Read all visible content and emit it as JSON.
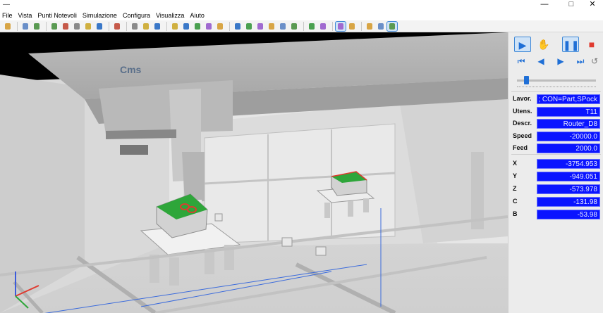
{
  "window": {
    "title": "",
    "controls": {
      "minimize": "—",
      "maximize": "□",
      "close": "✕"
    }
  },
  "menu": [
    "File",
    "Vista",
    "Punti Notevoli",
    "Simulazione",
    "Configura",
    "Visualizza",
    "Aiuto"
  ],
  "toolbar": {
    "groups": [
      [
        "open-icon"
      ],
      [
        "print-icon",
        "save-icon"
      ],
      [
        "zoom-in-icon",
        "zoom-out-icon",
        "zoom-window-icon",
        "zoom-previous-icon",
        "zoom-all-icon"
      ],
      [
        "fit-view-icon"
      ],
      [
        "camera-icon",
        "path-icon",
        "light-icon"
      ],
      [
        "edit-icon",
        "tools-icon",
        "stop-icon",
        "list-icon",
        "graph-icon"
      ],
      [
        "view-iso-icon",
        "view-front-icon",
        "view-right-icon",
        "view-top-icon",
        "view-left-icon",
        "view-back-icon"
      ],
      [
        "machine-icon",
        "collision-icon"
      ],
      [
        "check-icon",
        "fixture-icon"
      ],
      [
        "wireframe-icon",
        "hidden-lines-icon",
        "shaded-icon"
      ]
    ],
    "active": [
      "check-icon",
      "shaded-icon"
    ]
  },
  "viewport": {
    "brand_logo": "Cms"
  },
  "playback": {
    "buttons": [
      "play-icon",
      "hand-icon",
      "pause-icon",
      "stop-icon"
    ],
    "step_buttons": [
      "skip-start-icon",
      "step-back-icon",
      "step-forward-icon",
      "skip-end-icon",
      "reset-icon"
    ],
    "speed_fraction": 0.12
  },
  "info": [
    {
      "label": "Lavor.",
      "value": "; CON=Part,SPock"
    },
    {
      "label": "Utens.",
      "value": "T11"
    },
    {
      "label": "Descr.",
      "value": "Router_D8"
    },
    {
      "label": "Speed",
      "value": "-20000.0"
    },
    {
      "label": "Feed",
      "value": "2000.0"
    }
  ],
  "axes": [
    {
      "label": "X",
      "value": "-3754.953"
    },
    {
      "label": "Y",
      "value": "-949.051"
    },
    {
      "label": "Z",
      "value": "-573.978"
    },
    {
      "label": "C",
      "value": "-131.98"
    },
    {
      "label": "B",
      "value": "-53.98"
    }
  ],
  "colors": {
    "axis_value_bg": "#0a14ff",
    "accent_blue": "#1f6fd6",
    "part_green": "#2ea63a",
    "stop_red": "#e03a2f"
  }
}
